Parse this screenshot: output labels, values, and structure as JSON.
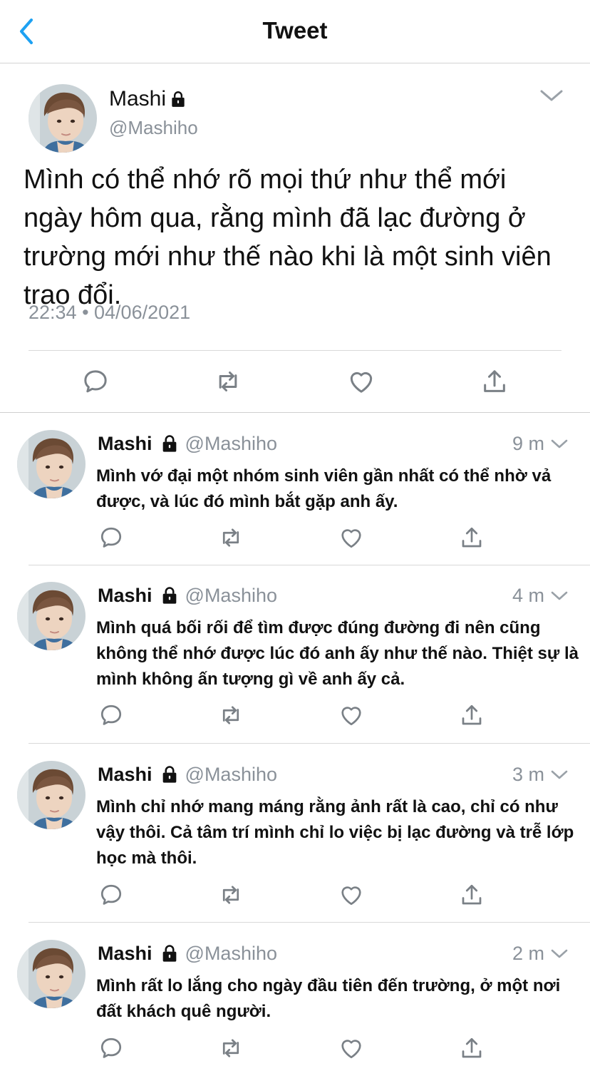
{
  "header": {
    "title": "Tweet"
  },
  "main_tweet": {
    "name": "Mashi",
    "handle": "@Mashiho",
    "text": "Mình có thể nhớ rõ mọi thứ như thể mới ngày hôm qua, rằng mình đã lạc đường ở trường mới như thế nào khi là một sinh viên trao đổi.",
    "timestamp": "22:34 • 04/06/2021"
  },
  "replies": [
    {
      "name": "Mashi",
      "handle": "@Mashiho",
      "time": "9 m",
      "text": "Mình vớ đại một nhóm sinh viên gần nhất có thể nhờ vả được, và lúc đó mình bắt gặp anh ấy."
    },
    {
      "name": "Mashi",
      "handle": "@Mashiho",
      "time": "4 m",
      "text": "Mình quá bối rối để tìm được đúng đường đi nên cũng không thể nhớ được lúc đó anh ấy như thế nào. Thiệt sự là mình không ấn tượng gì về anh ấy cả."
    },
    {
      "name": "Mashi",
      "handle": "@Mashiho",
      "time": "3 m",
      "text": "Mình chỉ nhớ mang máng rằng ảnh rất là cao, chỉ có như vậy thôi. Cả tâm trí mình chỉ lo việc bị lạc đường và trễ lớp học mà thôi."
    },
    {
      "name": "Mashi",
      "handle": "@Mashiho",
      "time": "2 m",
      "text": "Mình rất lo lắng cho ngày đầu tiên đến trường, ở một nơi đất khách quê người."
    }
  ],
  "icons": {
    "back": "chevron-left-icon",
    "lock": "lock-icon",
    "more": "chevron-down-icon",
    "reply": "reply-icon",
    "retweet": "retweet-icon",
    "like": "heart-icon",
    "share": "share-icon"
  },
  "colors": {
    "accent": "#1da1f2",
    "icon_gray": "#7a8086",
    "text_gray": "#8a9199"
  }
}
